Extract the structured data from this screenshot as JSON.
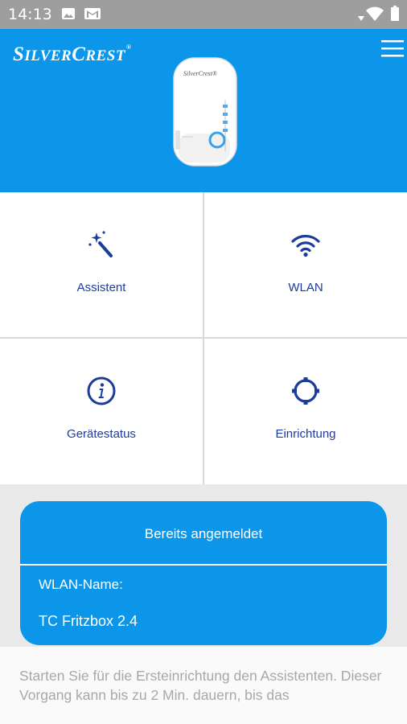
{
  "status_bar": {
    "time": "14:13",
    "icons": [
      "image-icon",
      "gmail-icon",
      "wifi-icon",
      "battery-icon"
    ]
  },
  "header": {
    "brand_first": "S",
    "brand_mid": "ILVER",
    "brand_c": "C",
    "brand_rest": "REST",
    "brand_reg": "®",
    "device_brand": "SilverCrest®",
    "menu_icon": "hamburger-menu-icon",
    "background_color": "#0b96e9"
  },
  "tiles": [
    {
      "label": "Assistent",
      "icon": "magic-wand-icon"
    },
    {
      "label": "WLAN",
      "icon": "wifi-icon"
    },
    {
      "label": "Gerätestatus",
      "icon": "info-icon"
    },
    {
      "label": "Einrichtung",
      "icon": "gear-icon"
    }
  ],
  "connection_card": {
    "title": "Bereits angemeldet",
    "ssid_label": "WLAN-Name:",
    "ssid_value": "TC Fritzbox 2.4"
  },
  "info_text": "Starten Sie für die Ersteinrichtung den Assistenten. Dieser Vorgang kann bis zu 2 Min. dauern, bis das"
}
